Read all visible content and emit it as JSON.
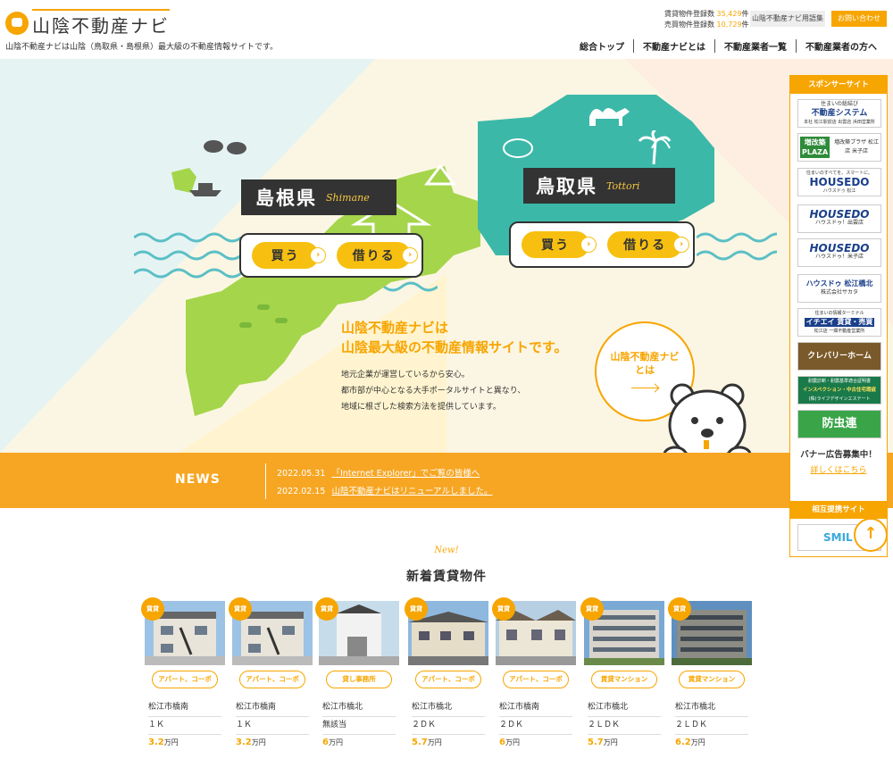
{
  "header": {
    "logo_text": "山陰不動産ナビ",
    "tagline": "山陰不動産ナビは山陰（鳥取県・島根県）最大級の不動産情報サイトです。",
    "counts": [
      {
        "label": "賃貸物件登録数",
        "value": "35,429",
        "unit": "件"
      },
      {
        "label": "売買物件登録数",
        "value": "10,729",
        "unit": "件"
      }
    ],
    "glossary_label": "山陰不動産ナビ用語集",
    "contact_label": "お問い合わせ",
    "nav": [
      "総合トップ",
      "不動産ナビとは",
      "不動産業者一覧",
      "不動産業者の方へ"
    ]
  },
  "hero": {
    "shimane": {
      "jp": "島根県",
      "en": "Shimane",
      "buy": "買う",
      "rent": "借りる"
    },
    "tottori": {
      "jp": "鳥取県",
      "en": "Tottori",
      "buy": "買う",
      "rent": "借りる"
    },
    "headline": [
      "山陰不動産ナビは",
      "山陰最大級の不動産情報サイトです。"
    ],
    "body": [
      "地元企業が運営しているから安心。",
      "都市部が中心となる大手ポータルサイトと異なり、",
      "地域に根ざした検索方法を提供しています。"
    ],
    "about_label": [
      "山陰不動産ナビ",
      "とは"
    ],
    "chev": "›"
  },
  "news": {
    "title": "NEWS",
    "items": [
      {
        "date": "2022.05.31",
        "text": "「Internet Explorer」でご覧の皆様へ"
      },
      {
        "date": "2022.02.15",
        "text": "山陰不動産ナビはリニューアルしました。"
      }
    ]
  },
  "new_arrivals": {
    "kicker": "New!",
    "title": "新着賃貸物件",
    "badge": "賃貸",
    "items": [
      {
        "type": "アパート、コーポ",
        "area": "松江市橋南",
        "layout": "１Ｋ",
        "price": "3.2",
        "unit": "万円"
      },
      {
        "type": "アパート、コーポ",
        "area": "松江市橋南",
        "layout": "１Ｋ",
        "price": "3.2",
        "unit": "万円"
      },
      {
        "type": "貸し事務所",
        "area": "松江市橋北",
        "layout": "無該当",
        "price": "6",
        "unit": "万円"
      },
      {
        "type": "アパート、コーポ",
        "area": "松江市橋北",
        "layout": "２ＤＫ",
        "price": "5.7",
        "unit": "万円"
      },
      {
        "type": "アパート、コーポ",
        "area": "松江市橋南",
        "layout": "２ＤＫ",
        "price": "6",
        "unit": "万円"
      },
      {
        "type": "賃貸マンション",
        "area": "松江市橋北",
        "layout": "２ＬＤＫ",
        "price": "5.7",
        "unit": "万円"
      },
      {
        "type": "賃貸マンション",
        "area": "松江市橋北",
        "layout": "２ＬＤＫ",
        "price": "6.2",
        "unit": "万円"
      }
    ]
  },
  "sidebar": {
    "sponsor_title": "スポンサーサイト",
    "banners": [
      {
        "top": "住まいの総結び",
        "main": "不動産システム",
        "sub": "本社 松江駅前店 出雲店 浜田営業所"
      },
      {
        "top": "増改築",
        "main": "PLAZA",
        "sub": "増改築プラザ 松江店 米子店"
      },
      {
        "top": "住まいのすべてを、スマートに。",
        "main": "HOUSEDO",
        "sub": "ハウスドゥ 松江"
      },
      {
        "top": "",
        "main": "HOUSEDO",
        "sub": "ハウスドゥ！出雲店"
      },
      {
        "top": "",
        "main": "HOUSEDO",
        "sub": "ハウスドゥ！米子店"
      },
      {
        "top": "",
        "main": "ハウスドゥ 松江橋北",
        "sub": "株式会社サカタ"
      },
      {
        "top": "住まいの情報ターミナル",
        "main": "イチエイ 賃貸・売買",
        "sub": "松江店 一畑不動産営業所"
      },
      {
        "top": "",
        "main": "クレバリーホーム",
        "sub": ""
      },
      {
        "top": "耐震診断・耐震基準適合証明書",
        "main": "インスペクション・中古住宅瑕疵",
        "sub": "(株)ライフデザインエステート"
      },
      {
        "top": "",
        "main": "防虫連",
        "sub": ""
      }
    ],
    "recruit_title": "バナー広告募集中！",
    "recruit_link": "詳しくはこちら",
    "partner_title": "相互提携サイト",
    "partner_banner": "SMIL"
  },
  "to_top": "↑",
  "colors": {
    "accent": "#f7a500",
    "green": "#a5d54b",
    "teal": "#3cb8a9",
    "dark": "#333333"
  }
}
